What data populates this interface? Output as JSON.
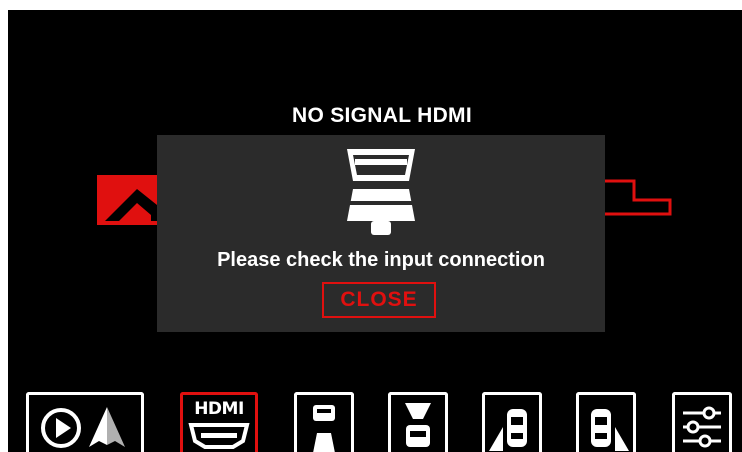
{
  "screen": {
    "title": "NO SIGNAL HDMI"
  },
  "dialog": {
    "icon": "hdmi-connector-icon",
    "message": "Please check the input connection",
    "close_label": "CLOSE"
  },
  "bottom_bar": {
    "items": [
      {
        "icon": "carplay-android-auto-icon",
        "active": false
      },
      {
        "icon": "hdmi-icon",
        "label": "HDMI",
        "active": true
      },
      {
        "icon": "front-camera-icon",
        "active": false
      },
      {
        "icon": "front-rear-camera-icon",
        "active": false
      },
      {
        "icon": "left-camera-icon",
        "active": false
      },
      {
        "icon": "right-camera-icon",
        "active": false
      },
      {
        "icon": "settings-sliders-icon",
        "active": false
      }
    ]
  },
  "colors": {
    "accent": "#e0100f",
    "background": "#000000",
    "dialog": "#2b2b2b",
    "text": "#ffffff"
  }
}
